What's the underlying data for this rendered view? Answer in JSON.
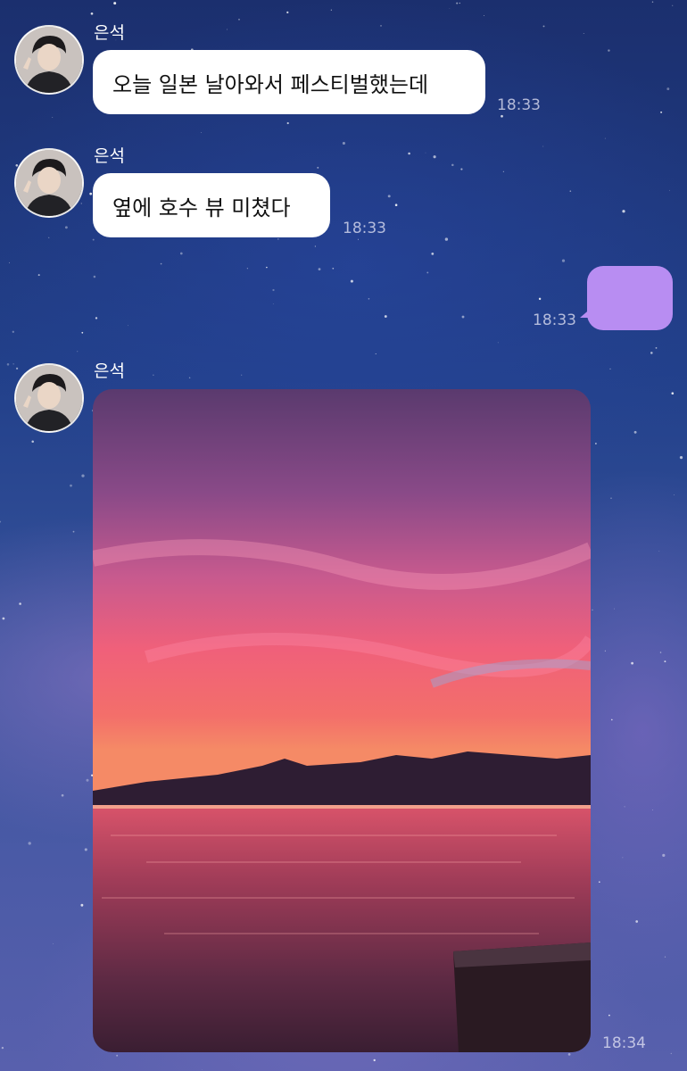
{
  "messages": [
    {
      "sender": "은석",
      "text": "오늘 일본 날아와서 페스티벌했는데",
      "time": "18:33"
    },
    {
      "sender": "은석",
      "text": "옆에 호수 뷰 미쳤다",
      "time": "18:33"
    },
    {
      "sender": "me",
      "text": "",
      "time": "18:33"
    },
    {
      "sender": "은석",
      "type": "photo",
      "photo_subject": "lake-sunset-photo",
      "time": "18:34"
    }
  ],
  "colors": {
    "my_bubble": "#b88df2",
    "their_bubble": "#ffffff",
    "timestamp": "#d8d8ec"
  }
}
